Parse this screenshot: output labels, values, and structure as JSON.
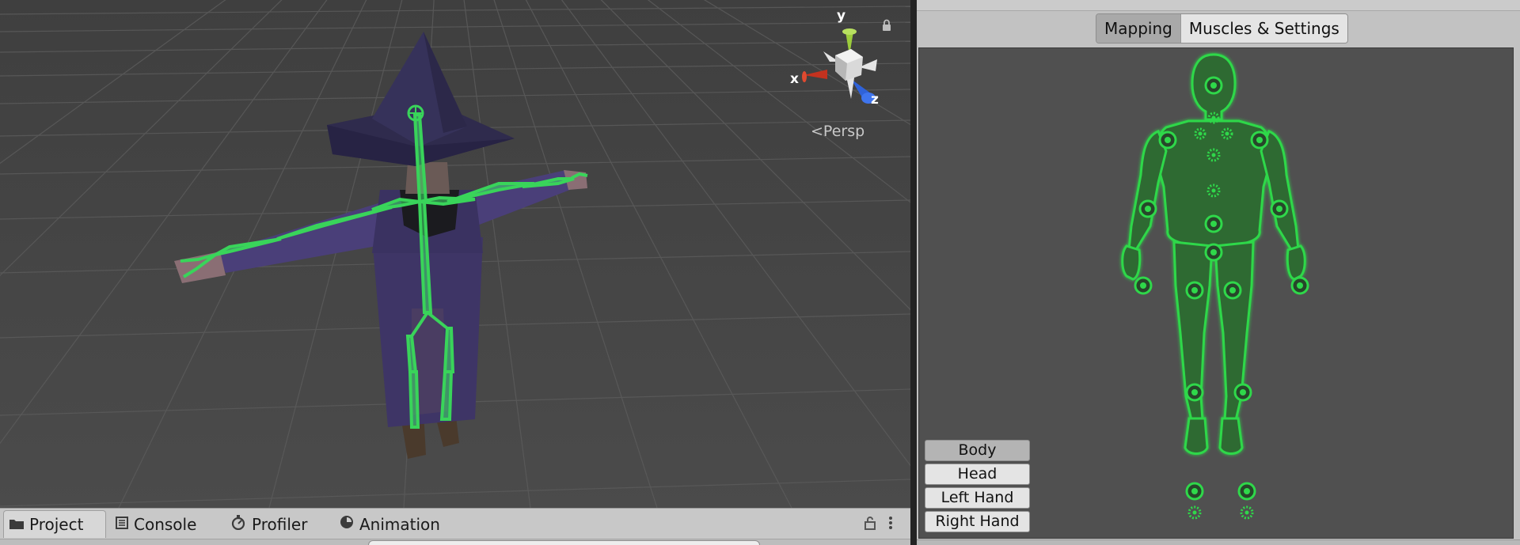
{
  "scene": {
    "view_mode_label": "Persp",
    "gizmo": {
      "x_label": "x",
      "y_label": "y",
      "z_label": "z"
    },
    "icons": [
      "lock-icon",
      "persp-arrow-icon",
      "orientation-gizmo-icon"
    ]
  },
  "inspector": {
    "tabs": [
      {
        "label": "Mapping",
        "active": true
      },
      {
        "label": "Muscles & Settings",
        "active": false
      }
    ],
    "body_parts": [
      {
        "label": "Body",
        "active": true
      },
      {
        "label": "Head",
        "active": false
      },
      {
        "label": "Left Hand",
        "active": false
      },
      {
        "label": "Right Hand",
        "active": false
      }
    ]
  },
  "bottom_panel": {
    "tabs": [
      {
        "label": "Project",
        "icon": "folder-icon",
        "active": true
      },
      {
        "label": "Console",
        "icon": "console-icon",
        "active": false
      },
      {
        "label": "Profiler",
        "icon": "profiler-icon",
        "active": false
      },
      {
        "label": "Animation",
        "icon": "animation-icon",
        "active": false
      }
    ]
  },
  "colors": {
    "bone_green": "#39d45a",
    "avatar_green": "#2fd84a",
    "scene_bg": "#474747",
    "avatar_bg": "#505050",
    "robe_purple": "#3e3566",
    "hat_purple": "#34305a"
  }
}
